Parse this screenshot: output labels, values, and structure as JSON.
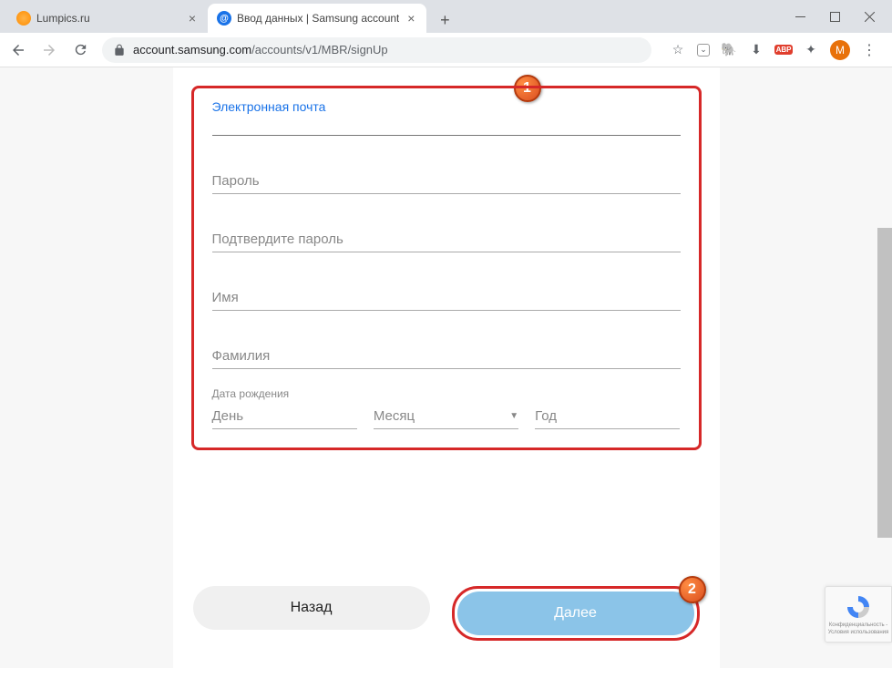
{
  "tabs": [
    {
      "title": "Lumpics.ru",
      "favicon": "orange"
    },
    {
      "title": "Ввод данных | Samsung account",
      "favicon": "blue",
      "active": true
    }
  ],
  "url": {
    "domain": "account.samsung.com",
    "path": "/accounts/v1/MBR/signUp"
  },
  "avatar_letter": "М",
  "form": {
    "email_label": "Электронная почта",
    "password_label": "Пароль",
    "confirm_password_label": "Подтвердите пароль",
    "first_name_label": "Имя",
    "last_name_label": "Фамилия",
    "dob_label": "Дата рождения",
    "day_label": "День",
    "month_label": "Месяц",
    "year_label": "Год"
  },
  "buttons": {
    "back": "Назад",
    "next": "Далее"
  },
  "callouts": {
    "one": "1",
    "two": "2"
  },
  "recaptcha": {
    "line1": "Конфиденциальность -",
    "line2": "Условия использования"
  }
}
